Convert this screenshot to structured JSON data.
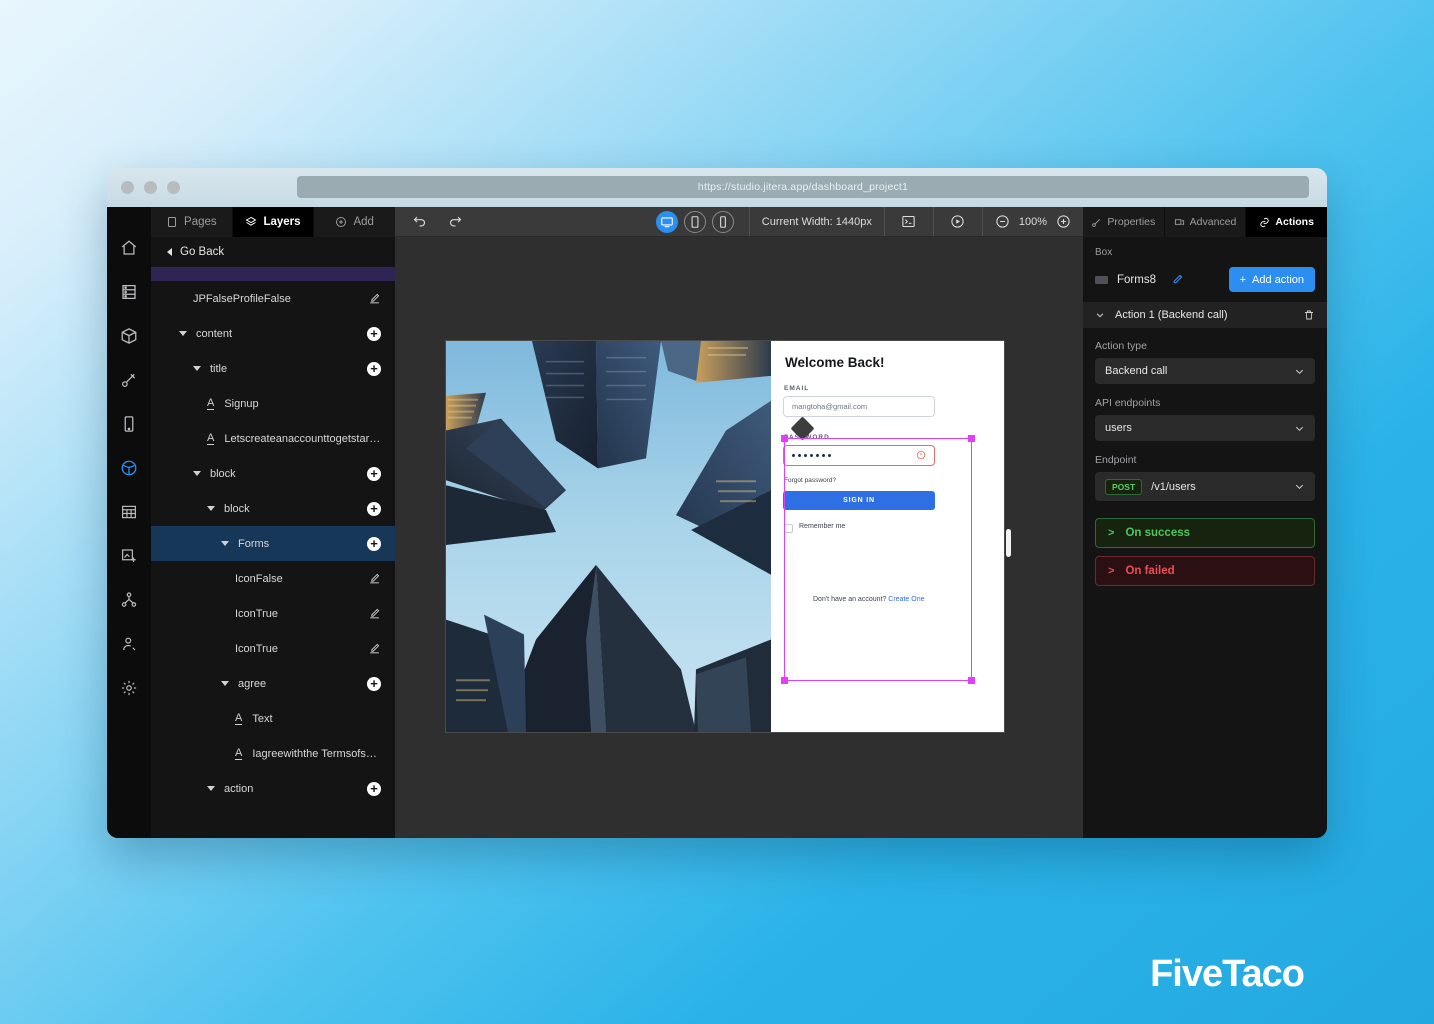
{
  "browser": {
    "url": "https://studio.jitera.app/dashboard_project1",
    "traffic_lights": [
      "close",
      "minimize",
      "maximize"
    ]
  },
  "rail": {
    "items": [
      {
        "name": "home",
        "icon": "home-icon",
        "active": false
      },
      {
        "name": "database",
        "icon": "database-icon",
        "active": false
      },
      {
        "name": "components",
        "icon": "cube-icon",
        "active": false
      },
      {
        "name": "theme",
        "icon": "brush-icon",
        "active": false
      },
      {
        "name": "mobile",
        "icon": "mobile-icon",
        "active": false
      },
      {
        "name": "web",
        "icon": "globe-icon",
        "active": true
      },
      {
        "name": "tables",
        "icon": "table-icon",
        "active": false
      },
      {
        "name": "assets",
        "icon": "image-add-icon",
        "active": false
      },
      {
        "name": "flows",
        "icon": "network-icon",
        "active": false
      },
      {
        "name": "roles",
        "icon": "user-search-icon",
        "active": false
      },
      {
        "name": "settings",
        "icon": "gear-icon",
        "active": false
      }
    ]
  },
  "layers_panel": {
    "tabs": [
      {
        "label": "Pages",
        "icon": "pages-icon",
        "active": false
      },
      {
        "label": "Layers",
        "icon": "layers-icon",
        "active": true
      },
      {
        "label": "Add",
        "icon": "plus-circle-icon",
        "active": false
      }
    ],
    "go_back": "Go Back",
    "tree": [
      {
        "label": "",
        "indent": 0,
        "type": "partial-highlight",
        "action": "none"
      },
      {
        "label": "JPFalseProfileFalse",
        "indent": 2,
        "type": "leaf",
        "action": "edit"
      },
      {
        "label": "content",
        "indent": 1,
        "type": "group",
        "action": "add"
      },
      {
        "label": "title",
        "indent": 2,
        "type": "group",
        "action": "add"
      },
      {
        "label": "Signup",
        "indent": 3,
        "type": "text",
        "action": "none"
      },
      {
        "label": "Letscreateanaccounttogetstarted",
        "indent": 3,
        "type": "text",
        "action": "none"
      },
      {
        "label": "block",
        "indent": 2,
        "type": "group",
        "action": "add"
      },
      {
        "label": "block",
        "indent": 3,
        "type": "group",
        "action": "add"
      },
      {
        "label": "Forms",
        "indent": 4,
        "type": "group",
        "action": "add",
        "selected": true
      },
      {
        "label": "IconFalse",
        "indent": 5,
        "type": "leaf",
        "action": "edit"
      },
      {
        "label": "IconTrue",
        "indent": 5,
        "type": "leaf",
        "action": "edit"
      },
      {
        "label": "IconTrue",
        "indent": 5,
        "type": "leaf",
        "action": "edit"
      },
      {
        "label": "agree",
        "indent": 4,
        "type": "group",
        "action": "add"
      },
      {
        "label": "Text",
        "indent": 5,
        "type": "text",
        "action": "none"
      },
      {
        "label": "Iagreewiththe Termsofservic...",
        "indent": 5,
        "type": "text",
        "action": "none"
      },
      {
        "label": "action",
        "indent": 3,
        "type": "group",
        "action": "add"
      }
    ]
  },
  "toolbar": {
    "undo_icon": "undo-icon",
    "redo_icon": "redo-icon",
    "devices": [
      {
        "name": "desktop",
        "icon": "desktop-icon",
        "active": true
      },
      {
        "name": "tablet",
        "icon": "tablet-icon",
        "active": false
      },
      {
        "name": "phone",
        "icon": "phone-icon",
        "active": false
      }
    ],
    "current_width": "Current Width: 1440px",
    "console_icon": "terminal-icon",
    "preview_icon": "play-circle-icon",
    "zoom_out_icon": "minus-circle-icon",
    "zoom_level": "100%",
    "zoom_in_icon": "plus-circle-icon"
  },
  "canvas": {
    "form": {
      "title": "Welcome Back!",
      "email_label": "EMAIL",
      "email_value": "mangtoha@gmail.com",
      "password_label": "PASSWORD",
      "password_value": "•••••••",
      "password_error_icon": "error-circle-icon",
      "forgot": "Forgot password?",
      "signin_button": "SIGN IN",
      "remember_label": "Remember me",
      "footer_text": "Don't have an account?",
      "footer_link": "Create One"
    },
    "photo_alt": "skyscrapers-looking-up-photo"
  },
  "right_panel": {
    "tabs": [
      {
        "label": "Properties",
        "icon": "properties-icon",
        "active": false
      },
      {
        "label": "Advanced",
        "icon": "advanced-icon",
        "active": false
      },
      {
        "label": "Actions",
        "icon": "link-icon",
        "active": true
      }
    ],
    "box_caption": "Box",
    "box_name": "Forms8",
    "box_edit_icon": "pencil-icon",
    "add_action_label": "Add action",
    "action": {
      "header": "Action 1 (Backend call)",
      "collapse_icon": "chevron-down-icon",
      "delete_icon": "trash-icon",
      "action_type_label": "Action type",
      "action_type_value": "Backend call",
      "api_endpoints_label": "API endpoints",
      "api_endpoints_value": "users",
      "endpoint_label": "Endpoint",
      "endpoint_method": "POST",
      "endpoint_path": "/v1/users",
      "on_success": "On success",
      "on_failed": "On failed"
    }
  },
  "watermark": "FiveTaco",
  "colors": {
    "accent_blue": "#2b8ef0",
    "selection_magenta": "#e040fb",
    "success_green": "#4ec65d",
    "error_red": "#ef4d55",
    "selected_row": "#163758",
    "highlight_purple": "#302454"
  }
}
